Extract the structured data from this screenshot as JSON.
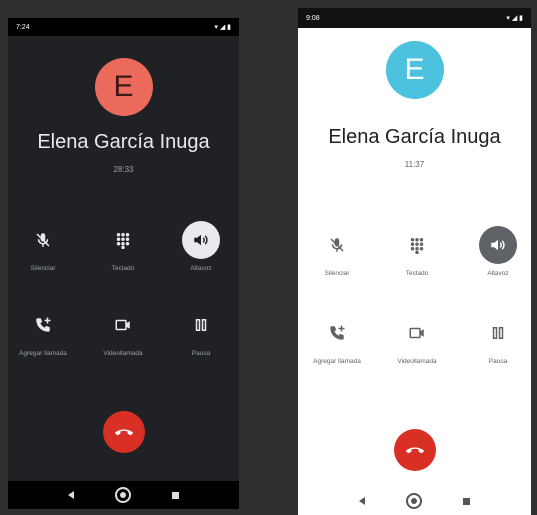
{
  "screens": [
    {
      "theme": "dark",
      "status_time": "7:24",
      "avatar_letter": "E",
      "contact_name": "Elena García Inuga",
      "call_time": "28:33",
      "controls": {
        "mute": "Silenciar",
        "keypad": "Teclado",
        "speaker": "Altavoz",
        "add_call": "Agregar llamada",
        "video_call": "Videollamada",
        "hold": "Pausa"
      }
    },
    {
      "theme": "light",
      "status_time": "9:08",
      "avatar_letter": "E",
      "contact_name": "Elena García Inuga",
      "call_time": "11:37",
      "controls": {
        "mute": "Silenciar",
        "keypad": "Teclado",
        "speaker": "Altavoz",
        "add_call": "Agregar llamada",
        "video_call": "Videollamada",
        "hold": "Pausa"
      }
    }
  ],
  "colors": {
    "end_call": "#d93025",
    "avatar_dark": "#ec6a5c",
    "avatar_light": "#4cc2df"
  }
}
